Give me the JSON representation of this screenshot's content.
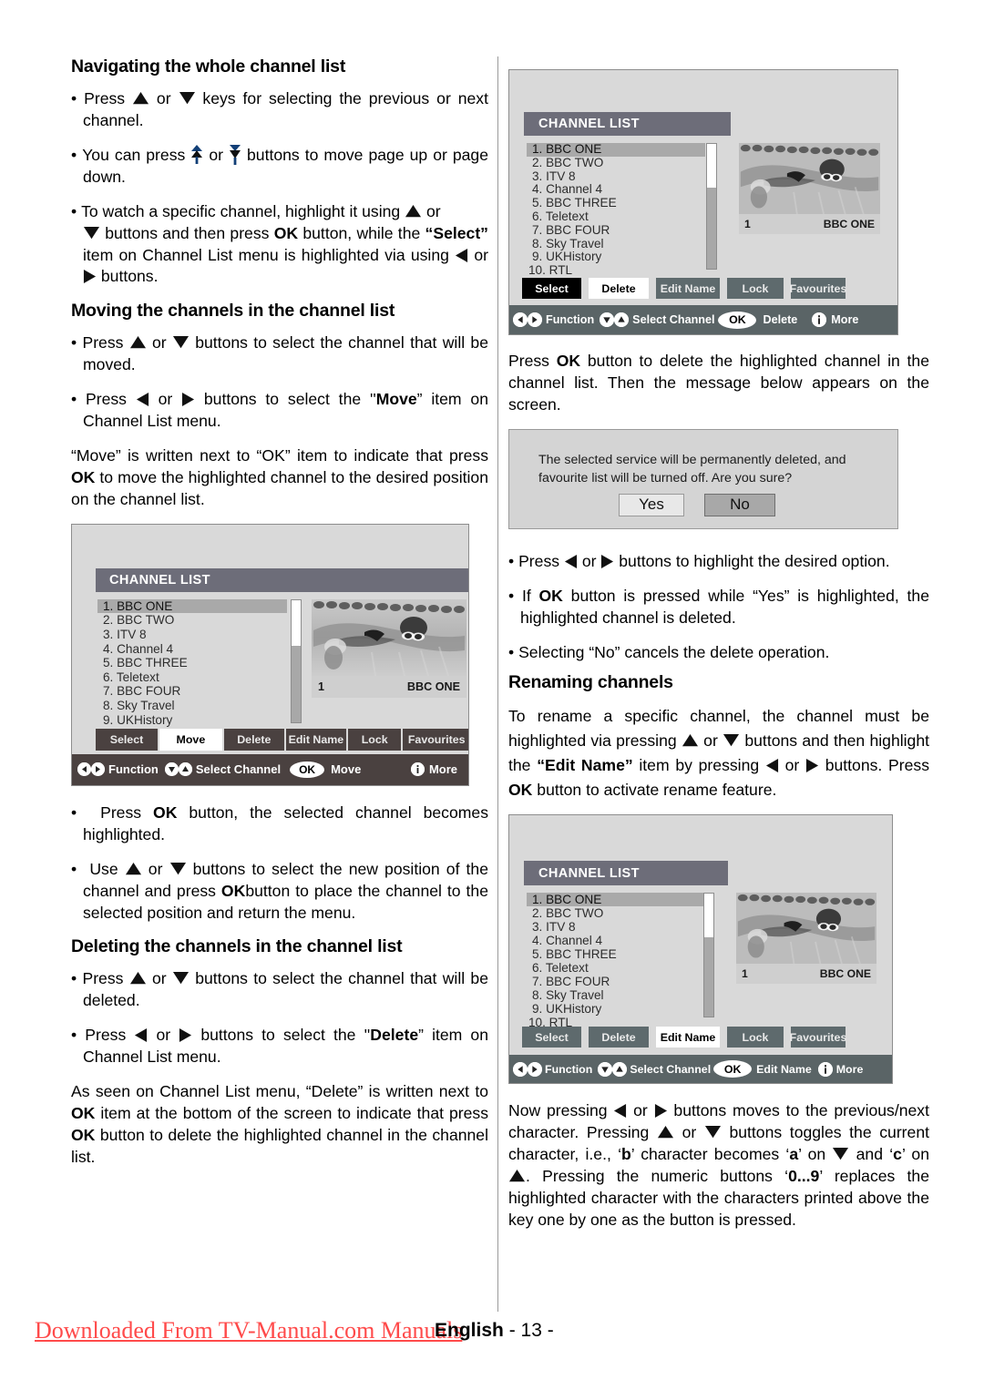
{
  "page": {
    "footer": {
      "watermark": "Downloaded From TV-Manual.com Manuals",
      "language": "English",
      "page_number": "- 13 -"
    }
  },
  "left_column": {
    "heading_navigating": "Navigating the whole channel list",
    "nav_bullets": [
      {
        "parts": [
          "Press ",
          "ARROW_UP",
          " or ",
          "ARROW_DOWN",
          " keys for selecting the previous or next channel."
        ]
      },
      {
        "parts": [
          "You can press ",
          "PAGE_UP",
          " or ",
          "PAGE_DOWN",
          " buttons to move page up or page down."
        ]
      }
    ],
    "nav_bullet3": {
      "t1": "To watch a specific channel, highlight it using ",
      "t2": " or ",
      "t3": " buttons and then press ",
      "ok": "OK",
      "t4": " button, while the ",
      "select_q": "“Select”",
      "t5": " item on Channel List menu is highlighted via using ",
      "t6": " or ",
      "t7": " buttons."
    },
    "heading_moving": "Moving the channels in the channel list",
    "move_bullet1": {
      "t1": "Press ",
      "t2": " or ",
      "t3": " buttons to select the channel that will be moved."
    },
    "move_bullet2": {
      "t1": "Press ",
      "t2": " or ",
      "t3": " buttons to select the ''",
      "bold": "Move",
      "t4": "” item on Channel List menu."
    },
    "move_para": {
      "t1": "“Move” is written next to “OK” item to indicate that press ",
      "ok": "OK",
      "t2": " to move the highlighted channel to the desired position on the channel list."
    },
    "after_shot_bullets": {
      "b1": {
        "t1": " Press ",
        "ok": "OK",
        "t2": " button, the selected channel becomes highlighted."
      },
      "b2": {
        "t1": " Use ",
        "t2": " or ",
        "t3": " buttons to select the new position of the channel and press ",
        "ok": "OK",
        "t4": "button to place the channel  to the selected position and return the menu."
      }
    },
    "heading_deleting": "Deleting the channels in the channel list",
    "del_bullet1": {
      "t1": "Press ",
      "t2": " or ",
      "t3": " buttons to select the channel that will be deleted."
    },
    "del_bullet2": {
      "t1": "Press ",
      "t2": " or ",
      "t3": " buttons to select the ''",
      "bold": "Delete",
      "t4": "” item on Channel List menu."
    },
    "del_para": {
      "t1": "As seen on Channel List menu, “Delete” is written next to ",
      "ok1": "OK",
      "t2": " item at the bottom of the screen to indicate that press ",
      "ok2": "OK",
      "t3": " button to delete the highlighted channel in the channel list."
    }
  },
  "right_column": {
    "delete_intro": {
      "t1": "Press ",
      "ok": "OK",
      "t2": " button to delete the highlighted channel in the channel list. Then the message below appears on the screen."
    },
    "dialog": {
      "message_line1": "The selected service will be permanently deleted, and",
      "message_line2": "favourite list will be turned off. Are you sure?",
      "yes_label": "Yes",
      "no_label": "No",
      "highlighted": "No"
    },
    "after_dialog_bullets": {
      "b1": {
        "t1": "Press ",
        "t2": " or ",
        "t3": " buttons to highlight the desired option."
      },
      "b2": {
        "t1": "If ",
        "ok": "OK",
        "t2": " button is pressed while “Yes” is highlighted, the highlighted channel is deleted."
      },
      "b3": {
        "t1": "Selecting “No” cancels the delete operation."
      }
    },
    "heading_renaming": "Renaming channels",
    "rename_para": {
      "t1": "To rename a specific channel, the channel must be highlighted via pressing ",
      "t2": " or ",
      "t3": " buttons and then highlight the ",
      "bold": "“Edit Name”",
      "t4": " item by pressing ",
      "t5": " or ",
      "t6": " buttons. Press ",
      "ok": "OK",
      "t7": " button to activate rename feature."
    },
    "rename_after": {
      "t1": "Now  pressing ",
      "t2": " or ",
      "t3": " buttons moves to the previous/next character. Pressing ",
      "t4": " or ",
      "t5": " buttons toggles the current character, i.e., ‘",
      "b1": "b",
      "t6": "’ character becomes ‘",
      "b2": "a",
      "t7": "’ on ",
      "t8": " and ‘",
      "b3": "c",
      "t9": "’ on ",
      "t10": ". Pressing the numeric buttons ‘",
      "b4": "0...9",
      "t11": "’ replaces the highlighted character with the characters printed above the key one by one as the button is pressed."
    }
  },
  "osd": {
    "title": "CHANNEL LIST",
    "channels": [
      "1. BBC ONE",
      "2. BBC TWO",
      "3. ITV 8",
      "4. Channel 4",
      "5. BBC THREE",
      "6. Teletext",
      "7. BBC FOUR",
      "8. Sky Travel",
      "9. UKHistory",
      "10. RTL"
    ],
    "selected_index": 0,
    "preview": {
      "number": "1",
      "name": "BBC ONE"
    },
    "buttons": [
      "Select",
      "Move",
      "Delete",
      "Edit Name",
      "Lock",
      "Favourites"
    ],
    "hint": {
      "function": "Function",
      "select_channel": "Select Channel",
      "ok": "OK",
      "more": "More"
    },
    "shot_move": {
      "buttons": [
        "Select",
        "Move",
        "Delete",
        "Edit Name",
        "Lock",
        "Favourites"
      ],
      "active_button": "Move",
      "ok_action": "Move",
      "theme": "brown"
    },
    "shot_delete": {
      "buttons": [
        "Select",
        "Delete",
        "Edit Name",
        "Lock",
        "Favourites"
      ],
      "active_button": "Delete",
      "ok_action": "Delete",
      "theme": "slate"
    },
    "shot_editname": {
      "buttons": [
        "Select",
        "Delete",
        "Edit Name",
        "Lock",
        "Favourites"
      ],
      "active_button": "Edit Name",
      "ok_action": "Edit Name",
      "theme": "slate"
    }
  },
  "colors": {
    "osd_bg": "#d9d9d9",
    "osd_title_bar": "#6d6d79",
    "row_selected": "#a9a9a9",
    "btn_dark": "#4a4140",
    "btn_gray": "#5e6a6d",
    "watermark_red": "#ff4a4a"
  }
}
